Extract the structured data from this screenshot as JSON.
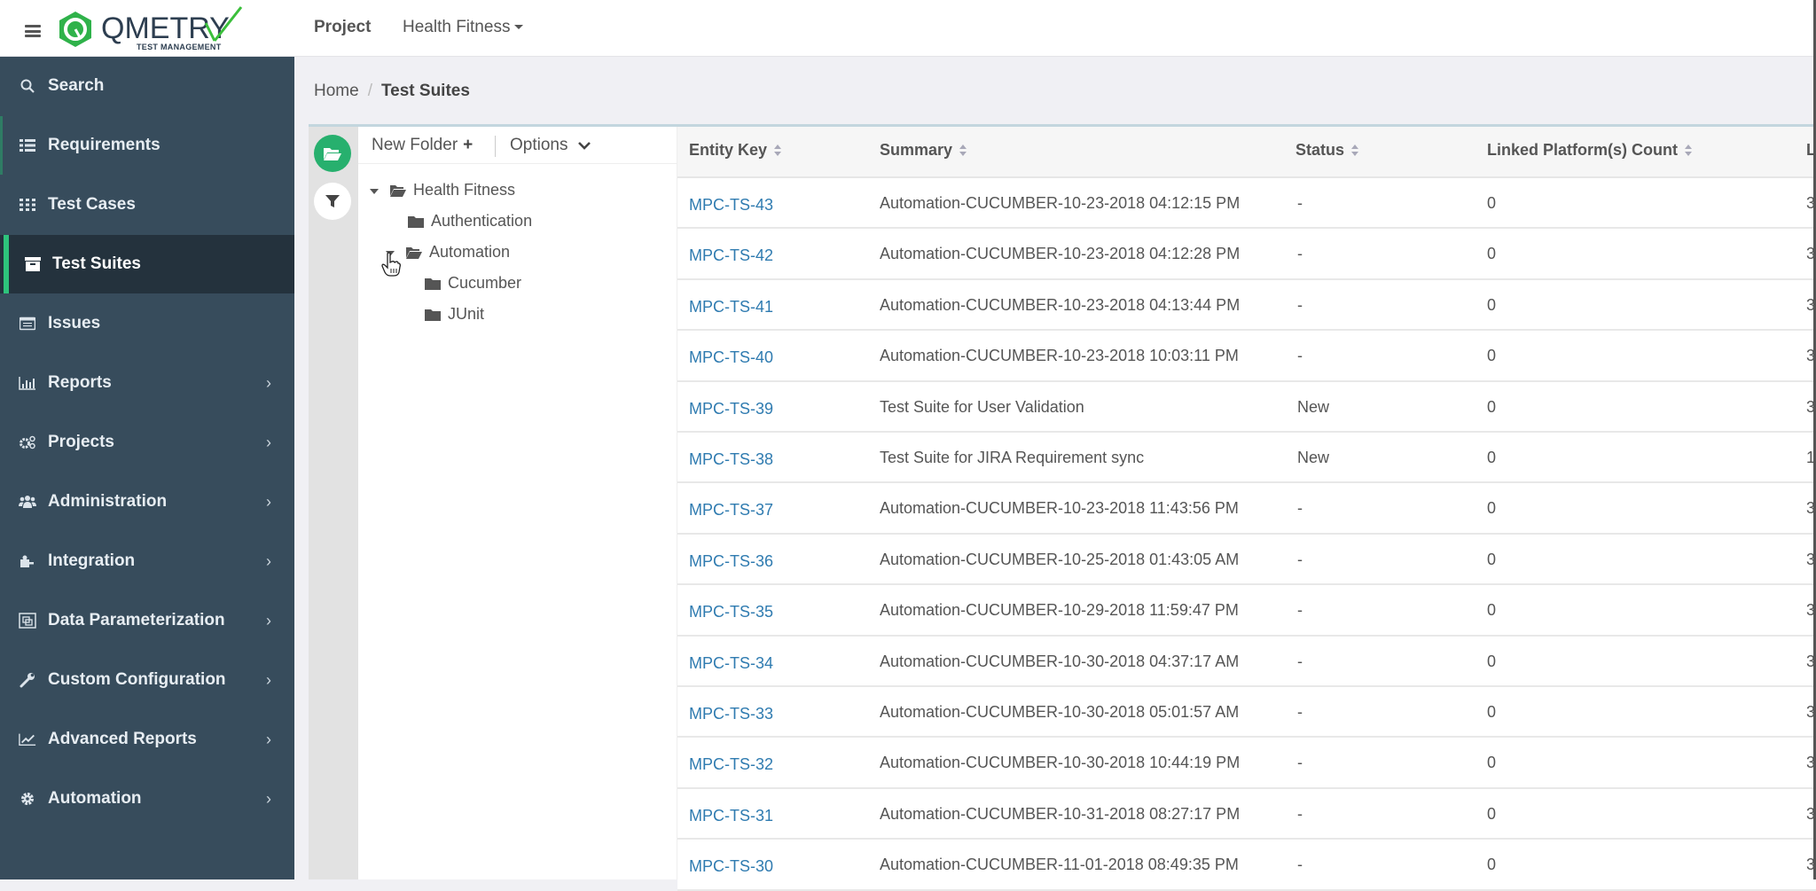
{
  "header": {
    "logo_text": "QMETRY",
    "logo_subtext": "TEST MANAGEMENT",
    "project_label": "Project",
    "project_selected": "Health Fitness"
  },
  "sidebar": {
    "items": [
      {
        "label": "Search",
        "icon": "search-icon",
        "has_submenu": false
      },
      {
        "label": "Requirements",
        "icon": "list-icon",
        "has_submenu": false
      },
      {
        "label": "Test Cases",
        "icon": "grid-icon",
        "has_submenu": false
      },
      {
        "label": "Test Suites",
        "icon": "archive-icon",
        "has_submenu": false,
        "active": true
      },
      {
        "label": "Issues",
        "icon": "issues-icon",
        "has_submenu": false
      },
      {
        "label": "Reports",
        "icon": "bar-chart-icon",
        "has_submenu": true
      },
      {
        "label": "Projects",
        "icon": "cogs-icon",
        "has_submenu": true
      },
      {
        "label": "Administration",
        "icon": "users-icon",
        "has_submenu": true
      },
      {
        "label": "Integration",
        "icon": "puzzle-icon",
        "has_submenu": true
      },
      {
        "label": "Data Parameterization",
        "icon": "data-icon",
        "has_submenu": true
      },
      {
        "label": "Custom Configuration",
        "icon": "wrench-icon",
        "has_submenu": true
      },
      {
        "label": "Advanced Reports",
        "icon": "line-chart-icon",
        "has_submenu": true
      },
      {
        "label": "Automation",
        "icon": "gear-icon",
        "has_submenu": true
      }
    ],
    "chevron": "›"
  },
  "breadcrumb": {
    "home": "Home",
    "separator": "/",
    "current": "Test Suites"
  },
  "tree": {
    "new_folder_label": "New Folder",
    "new_folder_plus": "+",
    "options_label": "Options",
    "nodes": [
      {
        "label": "Health Fitness",
        "level": 0,
        "expanded": true
      },
      {
        "label": "Authentication",
        "level": 1,
        "expanded": false
      },
      {
        "label": "Automation",
        "level": 1,
        "expanded": true
      },
      {
        "label": "Cucumber",
        "level": 2,
        "expanded": false
      },
      {
        "label": "JUnit",
        "level": 2,
        "expanded": false
      }
    ]
  },
  "table": {
    "columns": [
      "Entity Key",
      "Summary",
      "Status",
      "Linked Platform(s) Count",
      "L"
    ],
    "rows": [
      {
        "key": "MPC-TS-43",
        "summary": "Automation-CUCUMBER-10-23-2018 04:12:15 PM",
        "status": "-",
        "linked_platforms": "0",
        "last_col": "3"
      },
      {
        "key": "MPC-TS-42",
        "summary": "Automation-CUCUMBER-10-23-2018 04:12:28 PM",
        "status": "-",
        "linked_platforms": "0",
        "last_col": "3"
      },
      {
        "key": "MPC-TS-41",
        "summary": "Automation-CUCUMBER-10-23-2018 04:13:44 PM",
        "status": "-",
        "linked_platforms": "0",
        "last_col": "3"
      },
      {
        "key": "MPC-TS-40",
        "summary": "Automation-CUCUMBER-10-23-2018 10:03:11 PM",
        "status": "-",
        "linked_platforms": "0",
        "last_col": "3"
      },
      {
        "key": "MPC-TS-39",
        "summary": "Test Suite for User Validation",
        "status": "New",
        "linked_platforms": "0",
        "last_col": "3"
      },
      {
        "key": "MPC-TS-38",
        "summary": "Test Suite for JIRA Requirement sync",
        "status": "New",
        "linked_platforms": "0",
        "last_col": "1"
      },
      {
        "key": "MPC-TS-37",
        "summary": "Automation-CUCUMBER-10-23-2018 11:43:56 PM",
        "status": "-",
        "linked_platforms": "0",
        "last_col": "3"
      },
      {
        "key": "MPC-TS-36",
        "summary": "Automation-CUCUMBER-10-25-2018 01:43:05 AM",
        "status": "-",
        "linked_platforms": "0",
        "last_col": "3"
      },
      {
        "key": "MPC-TS-35",
        "summary": "Automation-CUCUMBER-10-29-2018 11:59:47 PM",
        "status": "-",
        "linked_platforms": "0",
        "last_col": "3"
      },
      {
        "key": "MPC-TS-34",
        "summary": "Automation-CUCUMBER-10-30-2018 04:37:17 AM",
        "status": "-",
        "linked_platforms": "0",
        "last_col": "3"
      },
      {
        "key": "MPC-TS-33",
        "summary": "Automation-CUCUMBER-10-30-2018 05:01:57 AM",
        "status": "-",
        "linked_platforms": "0",
        "last_col": "3"
      },
      {
        "key": "MPC-TS-32",
        "summary": "Automation-CUCUMBER-10-30-2018 10:44:19 PM",
        "status": "-",
        "linked_platforms": "0",
        "last_col": "3"
      },
      {
        "key": "MPC-TS-31",
        "summary": "Automation-CUCUMBER-10-31-2018 08:27:17 PM",
        "status": "-",
        "linked_platforms": "0",
        "last_col": "3"
      },
      {
        "key": "MPC-TS-30",
        "summary": "Automation-CUCUMBER-11-01-2018 08:49:35 PM",
        "status": "-",
        "linked_platforms": "0",
        "last_col": "3"
      }
    ]
  },
  "colors": {
    "brand_green": "#27b06e",
    "sidebar_bg": "#374c5c",
    "sidebar_active_bg": "#24323d",
    "link_blue": "#2f7bb0"
  }
}
